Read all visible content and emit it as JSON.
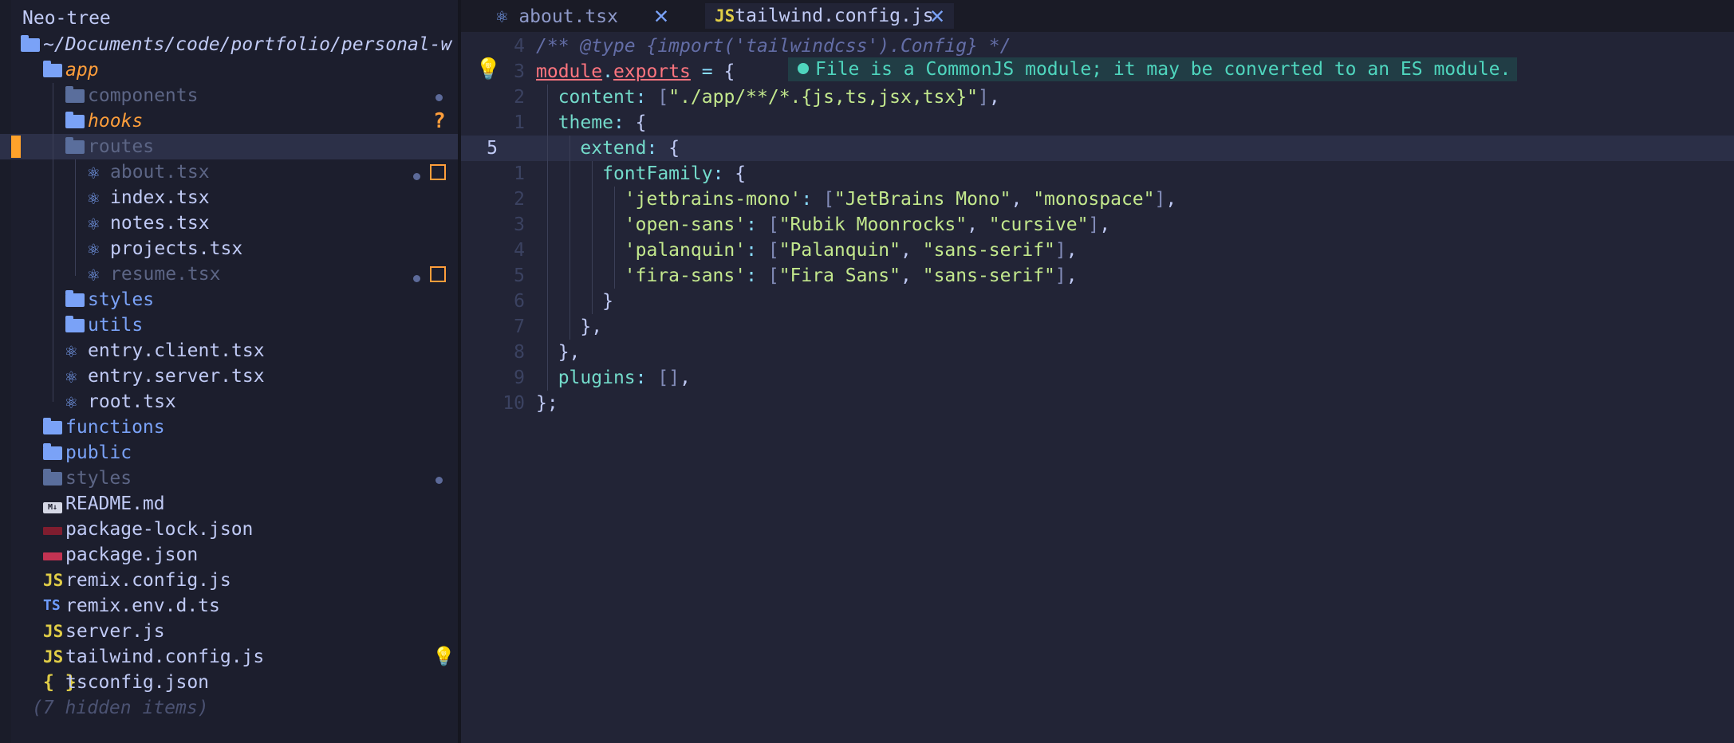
{
  "window": {
    "background": "#1f2233"
  },
  "tree": {
    "title": "Neo-tree",
    "root": "~/Documents/code/portfolio/personal-w",
    "items": [
      {
        "label": "app",
        "icon": "open-folder-icon",
        "style": "orange"
      },
      {
        "label": "components",
        "icon": "folder-icon",
        "style": "dim",
        "indicator": "dot"
      },
      {
        "label": "hooks",
        "icon": "folder-icon",
        "style": "orange",
        "indicator": "question"
      },
      {
        "label": "routes",
        "icon": "open-folder-icon",
        "style": "dim",
        "selected": true
      },
      {
        "label": "about.tsx",
        "icon": "react-icon",
        "style": "dim",
        "indicator": "dot-modified"
      },
      {
        "label": "index.tsx",
        "icon": "react-icon",
        "style": "white"
      },
      {
        "label": "notes.tsx",
        "icon": "react-icon",
        "style": "white"
      },
      {
        "label": "projects.tsx",
        "icon": "react-icon",
        "style": "white"
      },
      {
        "label": "resume.tsx",
        "icon": "react-icon",
        "style": "dim",
        "indicator": "dot-modified"
      },
      {
        "label": "styles",
        "icon": "folder-icon",
        "style": "folder"
      },
      {
        "label": "utils",
        "icon": "folder-icon",
        "style": "folder"
      },
      {
        "label": "entry.client.tsx",
        "icon": "react-icon",
        "style": "white"
      },
      {
        "label": "entry.server.tsx",
        "icon": "react-icon",
        "style": "white"
      },
      {
        "label": "root.tsx",
        "icon": "react-icon",
        "style": "white"
      },
      {
        "label": "functions",
        "icon": "folder-icon",
        "style": "folder"
      },
      {
        "label": "public",
        "icon": "folder-icon",
        "style": "folder"
      },
      {
        "label": "styles",
        "icon": "folder-icon",
        "style": "dim",
        "indicator": "dot"
      },
      {
        "label": "README.md",
        "icon": "markdown-icon",
        "style": "white"
      },
      {
        "label": "package-lock.json",
        "icon": "npm-icon",
        "style": "white"
      },
      {
        "label": "package.json",
        "icon": "npm-icon",
        "style": "white"
      },
      {
        "label": "remix.config.js",
        "icon": "js-icon",
        "style": "white"
      },
      {
        "label": "remix.env.d.ts",
        "icon": "ts-icon",
        "style": "white"
      },
      {
        "label": "server.js",
        "icon": "js-icon",
        "style": "white"
      },
      {
        "label": "tailwind.config.js",
        "icon": "js-icon",
        "style": "white",
        "indicator": "bulb"
      },
      {
        "label": "tsconfig.json",
        "icon": "json-icon",
        "style": "white"
      },
      {
        "label": "(7 hidden items)",
        "icon": "",
        "style": "hidden"
      }
    ],
    "icon_glyphs": {
      "js": "JS",
      "ts": "TS",
      "json": "{ }",
      "md": "M↓",
      "question": "?"
    }
  },
  "tabs": [
    {
      "label": "about.tsx",
      "icon": "react-icon",
      "active": false
    },
    {
      "label": "tailwind.config.js",
      "icon": "js-icon",
      "active": true
    }
  ],
  "editor": {
    "lines": [
      {
        "num": "4",
        "tokens": [
          [
            "k-com",
            "/** @type {import('tailwindcss').Config} */"
          ]
        ]
      },
      {
        "num": "3",
        "tokens": [
          [
            "k-var",
            "module"
          ],
          [
            "k-op",
            "."
          ],
          [
            "k-var",
            "exports"
          ],
          [
            "k-pun",
            " "
          ],
          [
            "k-op",
            "="
          ],
          [
            "k-pun",
            " {"
          ]
        ]
      },
      {
        "num": "2",
        "tokens": [
          [
            "k-pun",
            "  "
          ],
          [
            "k-key",
            "content"
          ],
          [
            "k-op",
            ":"
          ],
          [
            "k-pun",
            " "
          ],
          [
            "k-brk",
            "["
          ],
          [
            "k-str",
            "\"./app/**/*.{js,ts,jsx,tsx}\""
          ],
          [
            "k-brk",
            "]"
          ],
          [
            "k-pun",
            ","
          ]
        ]
      },
      {
        "num": "1",
        "tokens": [
          [
            "k-pun",
            "  "
          ],
          [
            "k-key",
            "theme"
          ],
          [
            "k-op",
            ":"
          ],
          [
            "k-pun",
            " {"
          ]
        ]
      },
      {
        "num": "5",
        "current": true,
        "tokens": [
          [
            "k-pun",
            "    "
          ],
          [
            "k-key",
            "extend"
          ],
          [
            "k-op",
            ":"
          ],
          [
            "k-pun",
            " {"
          ]
        ]
      },
      {
        "num": "1",
        "tokens": [
          [
            "k-pun",
            "      "
          ],
          [
            "k-key",
            "fontFamily"
          ],
          [
            "k-op",
            ":"
          ],
          [
            "k-pun",
            " {"
          ]
        ]
      },
      {
        "num": "2",
        "tokens": [
          [
            "k-pun",
            "        "
          ],
          [
            "k-str",
            "'jetbrains-mono'"
          ],
          [
            "k-op",
            ":"
          ],
          [
            "k-pun",
            " "
          ],
          [
            "k-brk",
            "["
          ],
          [
            "k-str",
            "\"JetBrains Mono\""
          ],
          [
            "k-pun",
            ", "
          ],
          [
            "k-str",
            "\"monospace\""
          ],
          [
            "k-brk",
            "]"
          ],
          [
            "k-pun",
            ","
          ]
        ]
      },
      {
        "num": "3",
        "tokens": [
          [
            "k-pun",
            "        "
          ],
          [
            "k-str",
            "'open-sans'"
          ],
          [
            "k-op",
            ":"
          ],
          [
            "k-pun",
            " "
          ],
          [
            "k-brk",
            "["
          ],
          [
            "k-str",
            "\"Rubik Moonrocks\""
          ],
          [
            "k-pun",
            ", "
          ],
          [
            "k-str",
            "\"cursive\""
          ],
          [
            "k-brk",
            "]"
          ],
          [
            "k-pun",
            ","
          ]
        ]
      },
      {
        "num": "4",
        "tokens": [
          [
            "k-pun",
            "        "
          ],
          [
            "k-str",
            "'palanquin'"
          ],
          [
            "k-op",
            ":"
          ],
          [
            "k-pun",
            " "
          ],
          [
            "k-brk",
            "["
          ],
          [
            "k-str",
            "\"Palanquin\""
          ],
          [
            "k-pun",
            ", "
          ],
          [
            "k-str",
            "\"sans-serif\""
          ],
          [
            "k-brk",
            "]"
          ],
          [
            "k-pun",
            ","
          ]
        ]
      },
      {
        "num": "5",
        "tokens": [
          [
            "k-pun",
            "        "
          ],
          [
            "k-str",
            "'fira-sans'"
          ],
          [
            "k-op",
            ":"
          ],
          [
            "k-pun",
            " "
          ],
          [
            "k-brk",
            "["
          ],
          [
            "k-str",
            "\"Fira Sans\""
          ],
          [
            "k-pun",
            ", "
          ],
          [
            "k-str",
            "\"sans-serif\""
          ],
          [
            "k-brk",
            "]"
          ],
          [
            "k-pun",
            ","
          ]
        ]
      },
      {
        "num": "6",
        "tokens": [
          [
            "k-pun",
            "      }"
          ]
        ]
      },
      {
        "num": "7",
        "tokens": [
          [
            "k-pun",
            "    },"
          ]
        ]
      },
      {
        "num": "8",
        "tokens": [
          [
            "k-pun",
            "  },"
          ]
        ]
      },
      {
        "num": "9",
        "tokens": [
          [
            "k-pun",
            "  "
          ],
          [
            "k-key",
            "plugins"
          ],
          [
            "k-op",
            ":"
          ],
          [
            "k-pun",
            " "
          ],
          [
            "k-brk",
            "[]"
          ],
          [
            "k-pun",
            ","
          ]
        ]
      },
      {
        "num": "10",
        "tokens": [
          [
            "k-pun",
            "};"
          ]
        ]
      }
    ],
    "diagnostic": "File is a CommonJS module; it may be converted to an ES module."
  },
  "colors": {
    "accent": "#7aa2f7",
    "modified": "#ff9e3b",
    "hint": "#4fd6be"
  }
}
